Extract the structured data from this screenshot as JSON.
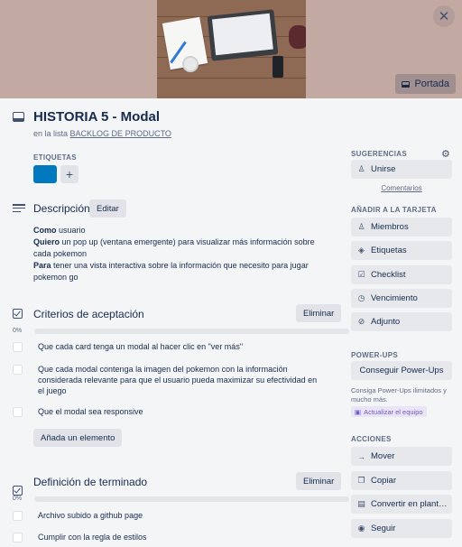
{
  "header": {
    "close_icon": "close-icon",
    "portada_label": "Portada",
    "title": "HISTORIA 5 - Modal",
    "list_prefix": "en la lista",
    "list_name": "BACKLOG DE PRODUCTO"
  },
  "labels": {
    "heading": "ETIQUETAS",
    "items": [
      {
        "color": "#0079bf"
      }
    ],
    "add_symbol": "+"
  },
  "description": {
    "heading": "Descripción",
    "edit_label": "Editar",
    "lines": [
      {
        "bold": "Como",
        "text": " usuario"
      },
      {
        "bold": "Quiero",
        "text": " un pop up (ventana emergente) para visualizar más información sobre cada pokemon"
      },
      {
        "bold": "Para",
        "text": " tener una vista interactiva sobre la información que necesito para jugar pokemon go"
      }
    ]
  },
  "checklists": [
    {
      "heading": "Criterios de aceptación",
      "delete_label": "Eliminar",
      "progress_text": "0%",
      "progress": 0,
      "items": [
        "Que cada card tenga un modal al hacer clic en \"ver más\"",
        "Que cada modal contenga la imagen del pokemon con la información considerada relevante para que el usuario pueda maximizar su efectividad en el juego",
        "Que el modal sea responsive"
      ],
      "add_item_label": "Añada un elemento"
    },
    {
      "heading": "Definición de terminado",
      "delete_label": "Eliminar",
      "progress_text": "0%",
      "progress": 0,
      "items": [
        "Archivo subido a github page",
        "Cumplir con la regla de estilos"
      ]
    }
  ],
  "sidebar": {
    "suggestions_heading": "SUGERENCIAS",
    "join_label": "Unirse",
    "comments_link": "Comentarios",
    "add_heading": "AÑADIR A LA TARJETA",
    "add_items": [
      {
        "label": "Miembros",
        "icon": "person-icon"
      },
      {
        "label": "Etiquetas",
        "icon": "tag-icon"
      },
      {
        "label": "Checklist",
        "icon": "checklist-icon"
      },
      {
        "label": "Vencimiento",
        "icon": "clock-icon"
      },
      {
        "label": "Adjunto",
        "icon": "paperclip-icon"
      }
    ],
    "powerups_heading": "POWER-UPS",
    "powerups_button": "Conseguir Power-Ups",
    "powerups_desc": "Consiga Power-Ups ilimitados y mucho más.",
    "upgrade_label": "Actualizar el equipo",
    "actions_heading": "ACCIONES",
    "actions": [
      {
        "label": "Mover",
        "icon": "arrow-right-icon"
      },
      {
        "label": "Copiar",
        "icon": "copy-icon"
      },
      {
        "label": "Convertir en plant…",
        "icon": "template-icon"
      },
      {
        "label": "Seguir",
        "icon": "eye-icon"
      }
    ]
  }
}
